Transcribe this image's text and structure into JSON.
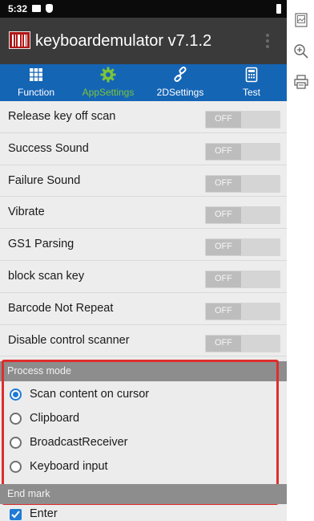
{
  "status_bar": {
    "time": "5:32"
  },
  "app_bar": {
    "title": "keyboardemulator v7.1.2"
  },
  "tabs": [
    {
      "label": "Function",
      "icon": "grid-icon",
      "active": false
    },
    {
      "label": "AppSettings",
      "icon": "gear-icon",
      "active": true
    },
    {
      "label": "2DSettings",
      "icon": "link-icon",
      "active": false
    },
    {
      "label": "Test",
      "icon": "calculator-icon",
      "active": false
    }
  ],
  "settings": [
    {
      "label": "Release key off scan",
      "state": "OFF"
    },
    {
      "label": "Success Sound",
      "state": "OFF"
    },
    {
      "label": "Failure Sound",
      "state": "OFF"
    },
    {
      "label": "Vibrate",
      "state": "OFF"
    },
    {
      "label": "GS1 Parsing",
      "state": "OFF"
    },
    {
      "label": "block scan key",
      "state": "OFF"
    },
    {
      "label": "Barcode Not Repeat",
      "state": "OFF"
    },
    {
      "label": "Disable control scanner",
      "state": "OFF"
    }
  ],
  "process_mode": {
    "header": "Process mode",
    "options": [
      {
        "label": "Scan content on cursor",
        "selected": true
      },
      {
        "label": "Clipboard",
        "selected": false
      },
      {
        "label": "BroadcastReceiver",
        "selected": false
      },
      {
        "label": "Keyboard input",
        "selected": false
      }
    ]
  },
  "end_mark": {
    "header": "End mark",
    "options": [
      {
        "label": "Enter",
        "checked": true
      }
    ]
  },
  "colors": {
    "tab_bar": "#1565b5",
    "active_tab": "#7cc43a",
    "app_bar": "#3a3a3a",
    "highlight_border": "#e02d2d",
    "radio_selected": "#1f7ad6"
  },
  "side_toolbar": [
    "image-icon",
    "zoom-in-icon",
    "print-icon"
  ]
}
